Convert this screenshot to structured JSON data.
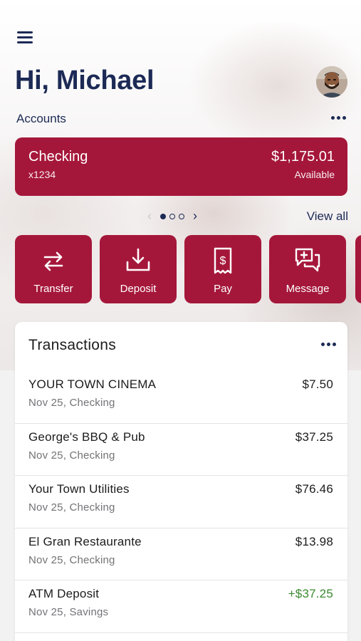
{
  "header": {
    "menu_icon": "hamburger-menu-icon",
    "greeting": "Hi, Michael",
    "avatar": "profile-avatar"
  },
  "accounts": {
    "label": "Accounts",
    "more_icon": "more-horizontal-icon",
    "card": {
      "name": "Checking",
      "number": "x1234",
      "balance": "$1,175.01",
      "balance_label": "Available"
    },
    "pager": {
      "current": 1,
      "total": 3
    },
    "view_all": "View all"
  },
  "actions": [
    {
      "label": "Transfer",
      "icon": "transfer-arrows-icon"
    },
    {
      "label": "Deposit",
      "icon": "deposit-tray-icon"
    },
    {
      "label": "Pay",
      "icon": "bill-pay-receipt-icon"
    },
    {
      "label": "Message",
      "icon": "message-plus-icon"
    }
  ],
  "transactions": {
    "title": "Transactions",
    "items": [
      {
        "name": "YOUR TOWN CINEMA",
        "meta": "Nov 25, Checking",
        "amount": "$7.50",
        "credit": false
      },
      {
        "name": "George's BBQ & Pub",
        "meta": "Nov 25, Checking",
        "amount": "$37.25",
        "credit": false
      },
      {
        "name": "Your Town Utilities",
        "meta": "Nov 25, Checking",
        "amount": "$76.46",
        "credit": false
      },
      {
        "name": "El Gran Restaurante",
        "meta": "Nov 25, Checking",
        "amount": "$13.98",
        "credit": false
      },
      {
        "name": "ATM Deposit",
        "meta": "Nov 25, Savings",
        "amount": "+$37.25",
        "credit": true
      }
    ]
  },
  "colors": {
    "brand": "#a5173a",
    "navy": "#1c2a55",
    "credit": "#3a8a2e"
  }
}
